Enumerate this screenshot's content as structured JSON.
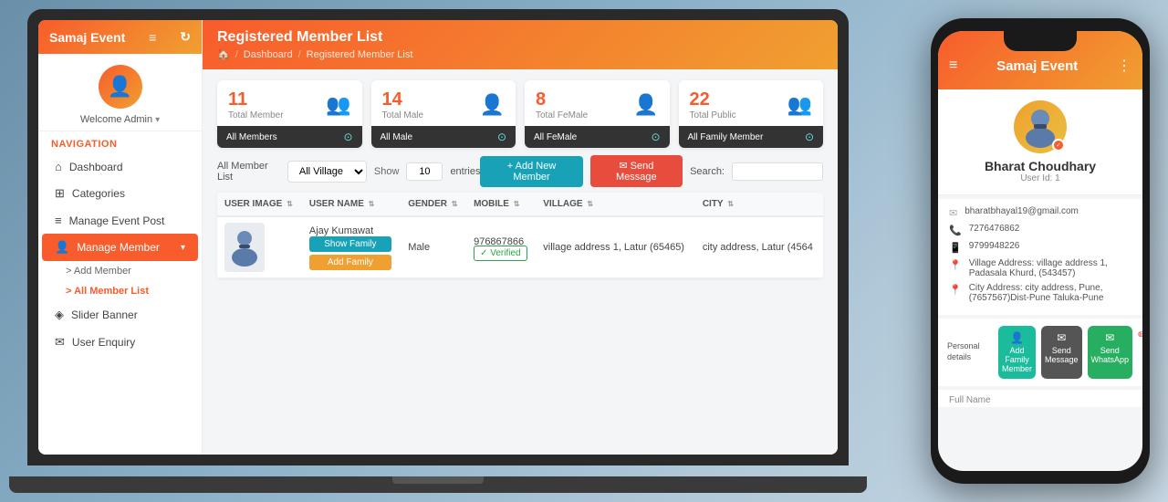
{
  "app": {
    "name": "Samaj Event",
    "menu_icon": "≡",
    "refresh_icon": "↻"
  },
  "sidebar": {
    "welcome_text": "Welcome Admin",
    "nav_label": "Navigation",
    "items": [
      {
        "id": "dashboard",
        "label": "Dashboard",
        "icon": "⌂",
        "active": false
      },
      {
        "id": "categories",
        "label": "Categories",
        "icon": "⊞",
        "active": false
      },
      {
        "id": "manage-event-post",
        "label": "Manage Event Post",
        "icon": "≡",
        "active": false
      },
      {
        "id": "manage-member",
        "label": "Manage Member",
        "icon": "👤",
        "active": true,
        "has_arrow": true
      },
      {
        "id": "slider-banner",
        "label": "Slider Banner",
        "icon": "◈",
        "active": false
      },
      {
        "id": "user-enquiry",
        "label": "User Enquiry",
        "icon": "✉",
        "active": false
      }
    ],
    "sub_items": [
      {
        "id": "add-member",
        "label": "Add Member",
        "active": false
      },
      {
        "id": "all-member-list",
        "label": "All Member List",
        "active": true
      }
    ]
  },
  "page": {
    "title": "Registered Member List",
    "breadcrumb": [
      "🏠",
      "Dashboard",
      "Registered Member List"
    ]
  },
  "stats": [
    {
      "number": "11",
      "label": "Total Member",
      "bottom": "All Members",
      "icon": "👤👤"
    },
    {
      "number": "14",
      "label": "Total Male",
      "bottom": "All Male",
      "icon": "👤"
    },
    {
      "number": "8",
      "label": "Total FeMale",
      "bottom": "All FeMale",
      "icon": "👤"
    },
    {
      "number": "22",
      "label": "Total Public",
      "bottom": "All Family Member",
      "icon": "👥"
    }
  ],
  "table": {
    "filter_label": "All Member List",
    "village_filter": "All Village",
    "show_label": "Show",
    "entries": "10",
    "entries_label": "entries",
    "search_label": "Search:",
    "add_btn": "+ Add New Member",
    "send_btn": "✉ Send Message",
    "columns": [
      "USER IMAGE",
      "USER NAME",
      "GENDER",
      "MOBILE",
      "VILLAGE",
      "CITY"
    ],
    "rows": [
      {
        "user_image": "person",
        "user_name": "Ajay Kumawat",
        "gender": "Male",
        "mobile": "976867866",
        "village": "village address 1, Latur (65465)",
        "city": "city address, Latur (4564",
        "show_family": "Show Family",
        "add_family": "Add Family",
        "verified": "✓ Verified"
      }
    ]
  },
  "phone": {
    "header_title": "Samaj Event",
    "menu_icon": "≡",
    "more_icon": "⋮",
    "profile": {
      "name": "Bharat Choudhary",
      "user_id": "User Id: 1",
      "verified_icon": "✓"
    },
    "contacts": [
      {
        "icon": "✉",
        "value": "bharatbhayal19@gmail.com"
      },
      {
        "icon": "📞",
        "value": "7276476862"
      },
      {
        "icon": "📱",
        "value": "9799948226"
      },
      {
        "icon": "📍",
        "value": "Village Address: village address 1, Padasala Khurd, (543457)"
      },
      {
        "icon": "📍",
        "value": "City Address: city address, Pune, (7657567)Dist-Pune Taluka-Pune"
      }
    ],
    "action_label": "Personal details",
    "action_btns": [
      {
        "label": "Add Family Member",
        "icon": "👤+",
        "color": "teal"
      },
      {
        "label": "Send Message",
        "icon": "✉",
        "color": "gray"
      },
      {
        "label": "Send WhatsApp",
        "icon": "✉",
        "color": "green"
      }
    ],
    "field_label": "Full Name"
  }
}
